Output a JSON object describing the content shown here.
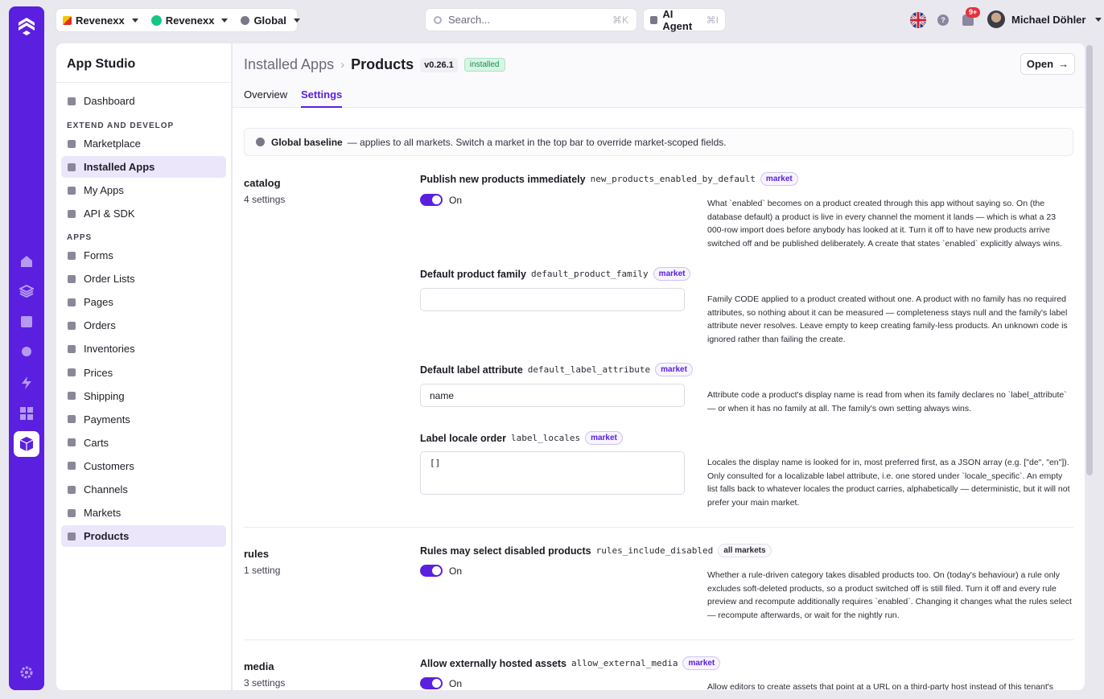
{
  "topbar": {
    "org1": "Revenexx",
    "org2": "Revenexx",
    "scope": "Global",
    "search_placeholder": "Search...",
    "search_kbd": "⌘K",
    "agent_label": "AI Agent",
    "agent_kbd": "⌘I",
    "notif_count": "9+",
    "user_name": "Michael Döhler"
  },
  "sidebar": {
    "title": "App Studio",
    "dashboard": "Dashboard",
    "section1": "EXTEND AND DEVELOP",
    "extend": [
      "Marketplace",
      "Installed Apps",
      "My Apps",
      "API & SDK"
    ],
    "section2": "APPS",
    "apps": [
      "Forms",
      "Order Lists",
      "Pages",
      "Orders",
      "Inventories",
      "Prices",
      "Shipping",
      "Payments",
      "Carts",
      "Customers",
      "Channels",
      "Markets",
      "Products"
    ]
  },
  "header": {
    "crumb_parent": "Installed Apps",
    "crumb_current": "Products",
    "version": "v0.26.1",
    "status": "installed",
    "open_label": "Open"
  },
  "tabs": [
    "Overview",
    "Settings"
  ],
  "banner": {
    "title": "Global baseline",
    "text": "— applies to all markets. Switch a market in the top bar to override market-scoped fields."
  },
  "groups": [
    {
      "name": "catalog",
      "count": "4 settings"
    },
    {
      "name": "rules",
      "count": "1 setting"
    },
    {
      "name": "media",
      "count": "3 settings"
    }
  ],
  "settings": [
    {
      "label": "Publish new products immediately",
      "key": "new_products_enabled_by_default",
      "scope": "market",
      "value": "On",
      "help": "What `enabled` becomes on a product created through this app without saying so. On (the database default) a product is live in every channel the moment it lands — which is what a 23 000-row import does before anybody has looked at it. Turn it off to have new products arrive switched off and be published deliberately. A create that states `enabled` explicitly always wins."
    },
    {
      "label": "Default product family",
      "key": "default_product_family",
      "scope": "market",
      "value": "",
      "help": "Family CODE applied to a product created without one. A product with no family has no required attributes, so nothing about it can be measured — completeness stays null and the family's label attribute never resolves. Leave empty to keep creating family-less products. An unknown code is ignored rather than failing the create."
    },
    {
      "label": "Default label attribute",
      "key": "default_label_attribute",
      "scope": "market",
      "value": "name",
      "help": "Attribute code a product's display name is read from when its family declares no `label_attribute` — or when it has no family at all. The family's own setting always wins."
    },
    {
      "label": "Label locale order",
      "key": "label_locales",
      "scope": "market",
      "value": "[]",
      "help": "Locales the display name is looked for in, most preferred first, as a JSON array (e.g. [\"de\", \"en\"]). Only consulted for a localizable label attribute, i.e. one stored under `locale_specific`. An empty list falls back to whatever locales the product carries, alphabetically — deterministic, but it will not prefer your main market."
    },
    {
      "label": "Rules may select disabled products",
      "key": "rules_include_disabled",
      "scope": "all markets",
      "value": "On",
      "help": "Whether a rule-driven category takes disabled products too. On (today's behaviour) a rule only excludes soft-deleted products, so a product switched off is still filed. Turn it off and every rule preview and recompute additionally requires `enabled`. Changing it changes what the rules select — recompute afterwards, or wait for the nightly run."
    },
    {
      "label": "Allow externally hosted assets",
      "key": "allow_external_media",
      "scope": "market",
      "value": "On",
      "help": "Allow editors to create assets that point at a URL on a third-party host instead of this tenant's"
    }
  ],
  "colors": {
    "accent": "#5b1fe0",
    "installed": "#178a4e"
  }
}
